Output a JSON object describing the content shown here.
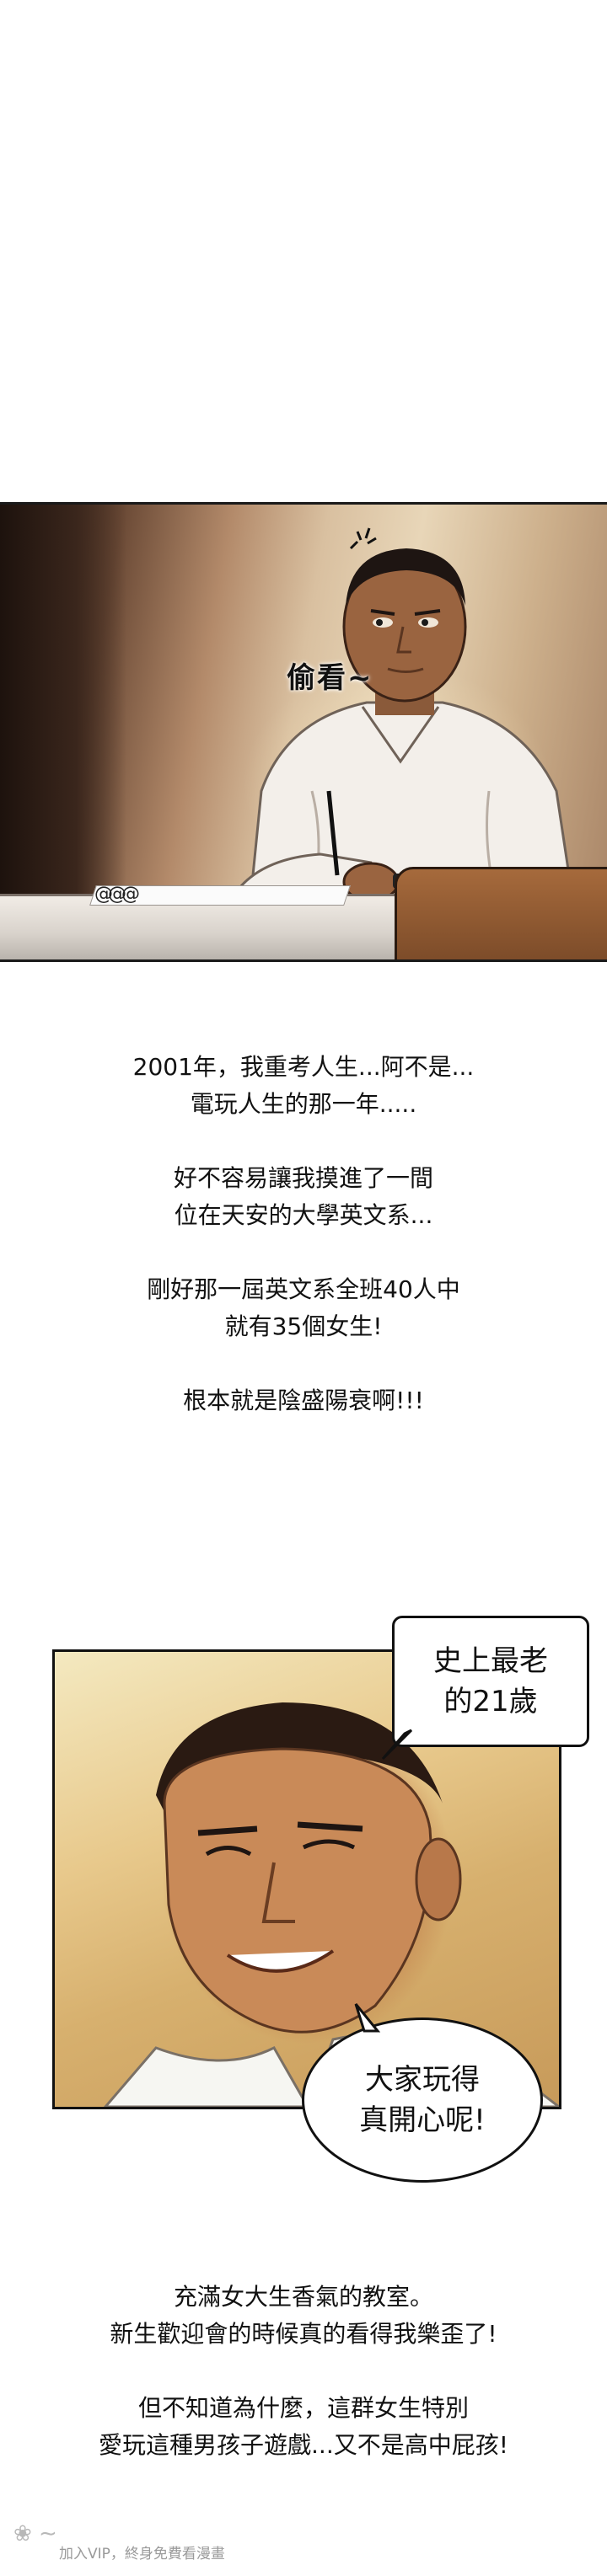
{
  "panel_office": {
    "sfx_text": "偷看~"
  },
  "narration_1": {
    "lines": [
      "2001年，我重考人生...阿不是...",
      "電玩人生的那一年.....",
      "",
      "好不容易讓我摸進了一間",
      "位在天安的大學英文系...",
      "",
      "剛好那一屆英文系全班40人中",
      "就有35個女生!",
      "",
      "根本就是陰盛陽衰啊!!!"
    ]
  },
  "panel_portrait": {
    "bubble_top": [
      "史上最老",
      "的21歲"
    ],
    "bubble_bottom": [
      "大家玩得",
      "真開心呢!"
    ]
  },
  "narration_2": {
    "lines": [
      "充滿女大生香氣的教室。",
      "新生歡迎會的時候真的看得我樂歪了!",
      "",
      "但不知道為什麼，這群女生特別",
      "愛玩這種男孩子遊戲...又不是高中屁孩!"
    ]
  },
  "watermark": {
    "text": "加入VIP，終身免費看漫畫"
  }
}
